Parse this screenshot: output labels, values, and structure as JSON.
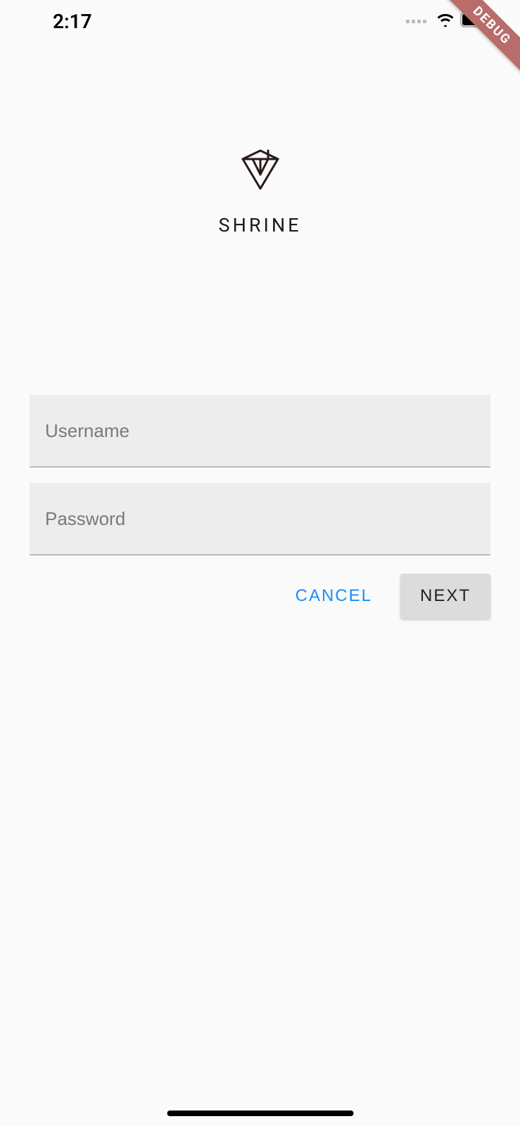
{
  "status_bar": {
    "time": "2:17"
  },
  "debug_banner": "DEBUG",
  "brand": {
    "title": "SHRINE"
  },
  "form": {
    "username_placeholder": "Username",
    "password_placeholder": "Password"
  },
  "buttons": {
    "cancel_label": "CANCEL",
    "next_label": "NEXT"
  }
}
